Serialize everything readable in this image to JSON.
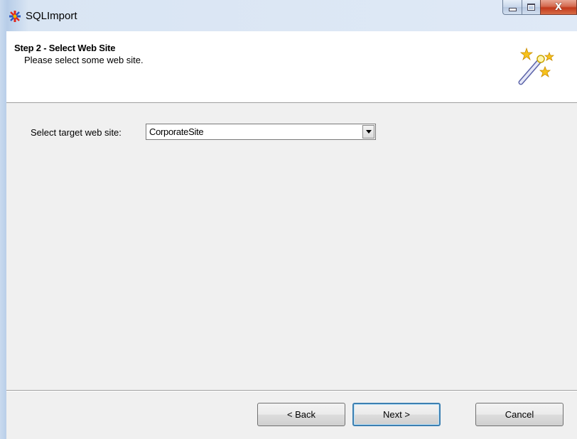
{
  "window": {
    "title": "SQLImport",
    "icons": {
      "app": "asterisk-app-icon",
      "minimize": "minimize-icon",
      "maximize": "maximize-icon",
      "close": "close-icon"
    },
    "close_glyph": "X"
  },
  "header": {
    "step_title": "Step 2 - Select Web Site",
    "step_subtitle": "Please select some web site.",
    "icon": "magic-wand-icon"
  },
  "form": {
    "target_site_label": "Select target web site:",
    "target_site_value": "CorporateSite"
  },
  "buttons": {
    "back": "< Back",
    "next": "Next >",
    "cancel": "Cancel"
  },
  "colors": {
    "app_icon_red": "#e0261b",
    "app_icon_blue": "#2b59c3",
    "default_button_border": "#3c7fb1"
  }
}
